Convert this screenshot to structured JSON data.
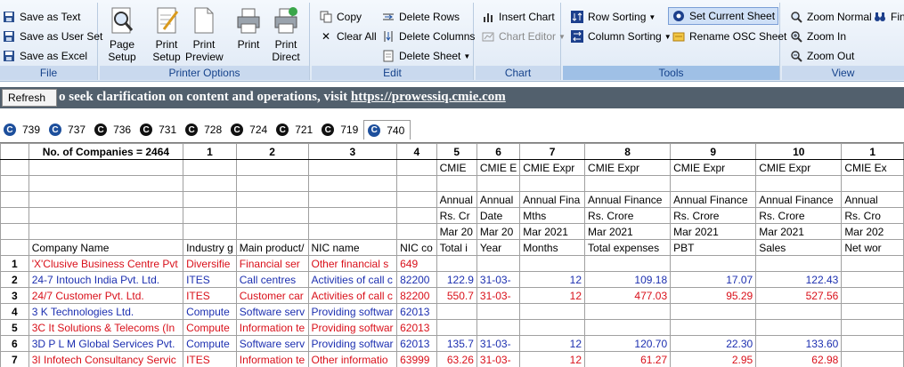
{
  "ribbon": {
    "file": {
      "label": "File",
      "items": [
        "Save as Text",
        "Save as User Set",
        "Save as Excel"
      ]
    },
    "printer": {
      "label": "Printer Options",
      "buttons": [
        {
          "line1": "Page",
          "line2": "Setup"
        },
        {
          "line1": "Print",
          "line2": "Setup"
        },
        {
          "line1": "Print",
          "line2": "Preview"
        },
        {
          "line1": "Print",
          "line2": ""
        },
        {
          "line1": "Print",
          "line2": "Direct"
        }
      ]
    },
    "edit": {
      "label": "Edit",
      "copy": "Copy",
      "clear_all": "Clear All",
      "delete_rows": "Delete Rows",
      "delete_columns": "Delete Columns",
      "delete_sheet": "Delete Sheet"
    },
    "chart": {
      "label": "Chart",
      "insert_chart": "Insert Chart",
      "chart_editor": "Chart Editor"
    },
    "tools": {
      "label": "Tools",
      "row_sorting": "Row Sorting",
      "column_sorting": "Column Sorting",
      "set_current_sheet": "Set Current Sheet",
      "rename_osc_sheet": "Rename OSC Sheet"
    },
    "view": {
      "label": "View",
      "zoom_normal": "Zoom Normal",
      "zoom_in": "Zoom In",
      "zoom_out": "Zoom Out",
      "find": "Find"
    }
  },
  "infobar": {
    "refresh": "Refresh",
    "text": "o seek clarification on content and operations, visit ",
    "link": "https://prowessiq.cmie.com"
  },
  "tabs": [
    {
      "label": "739",
      "style": "blue",
      "active": false
    },
    {
      "label": "737",
      "style": "blue",
      "active": false
    },
    {
      "label": "736",
      "style": "black",
      "active": false
    },
    {
      "label": "731",
      "style": "black",
      "active": false
    },
    {
      "label": "728",
      "style": "black",
      "active": false
    },
    {
      "label": "724",
      "style": "black",
      "active": false
    },
    {
      "label": "721",
      "style": "black",
      "active": false
    },
    {
      "label": "719",
      "style": "black",
      "active": false
    },
    {
      "label": "740",
      "style": "blue",
      "active": true
    }
  ],
  "grid": {
    "header": [
      "",
      "No. of Companies = 2464",
      "1",
      "2",
      "3",
      "4",
      "5",
      "6",
      "7",
      "8",
      "9",
      "10",
      "1"
    ],
    "meta_rows": [
      [
        "",
        "",
        "",
        "",
        "",
        "",
        "CMIE",
        "CMIE E",
        "CMIE Expr",
        "CMIE Expr",
        "CMIE Expr",
        "CMIE Expr",
        "CMIE Ex"
      ],
      [
        "",
        "",
        "",
        "",
        "",
        "",
        "",
        "",
        "",
        "",
        "",
        "",
        ""
      ],
      [
        "",
        "",
        "",
        "",
        "",
        "",
        "Annual",
        "Annual",
        "Annual Fina",
        "Annual Finance",
        "Annual Finance",
        "Annual Finance",
        "Annual"
      ],
      [
        "",
        "",
        "",
        "",
        "",
        "",
        "Rs. Cr",
        "Date",
        "Mths",
        "Rs. Crore",
        "Rs. Crore",
        "Rs. Crore",
        "Rs. Cro"
      ],
      [
        "",
        "",
        "",
        "",
        "",
        "",
        "Mar 20",
        "Mar 20",
        "Mar 2021",
        "Mar 2021",
        "Mar 2021",
        "Mar 2021",
        "Mar 202"
      ],
      [
        "",
        "Company Name",
        "Industry g",
        "Main product/",
        "NIC name",
        "NIC co",
        "Total i",
        "Year",
        "Months",
        "Total expenses",
        "PBT",
        "Sales",
        "Net wor"
      ]
    ],
    "rows": [
      {
        "n": "1",
        "color": "red",
        "cells": [
          "'X'Clusive Business Centre Pvt",
          "Diversifie",
          "Financial ser",
          "Other financial s",
          "649",
          "",
          "",
          "",
          "",
          "",
          "",
          ""
        ]
      },
      {
        "n": "2",
        "color": "blue",
        "cells": [
          "24-7 Intouch India Pvt. Ltd.",
          "ITES",
          "Call centres",
          "Activities of call c",
          "82200",
          "122.9",
          "31-03-",
          "12",
          "109.18",
          "17.07",
          "122.43",
          ""
        ]
      },
      {
        "n": "3",
        "color": "red",
        "cells": [
          "24/7 Customer Pvt. Ltd.",
          "ITES",
          "Customer car",
          "Activities of call c",
          "82200",
          "550.7",
          "31-03-",
          "12",
          "477.03",
          "95.29",
          "527.56",
          ""
        ]
      },
      {
        "n": "4",
        "color": "blue",
        "cells": [
          "3 K Technologies Ltd.",
          "Compute",
          "Software serv",
          "Providing softwar",
          "62013",
          "",
          "",
          "",
          "",
          "",
          "",
          ""
        ]
      },
      {
        "n": "5",
        "color": "red",
        "cells": [
          "3C It Solutions & Telecoms (In",
          "Compute",
          "Information te",
          "Providing softwar",
          "62013",
          "",
          "",
          "",
          "",
          "",
          "",
          ""
        ]
      },
      {
        "n": "6",
        "color": "blue",
        "cells": [
          "3D P L M Global Services Pvt.",
          "Compute",
          "Software serv",
          "Providing softwar",
          "62013",
          "135.7",
          "31-03-",
          "12",
          "120.70",
          "22.30",
          "133.60",
          ""
        ]
      },
      {
        "n": "7",
        "color": "red",
        "cells": [
          "3I Infotech Consultancy Servic",
          "ITES",
          "Information te",
          "Other informatio",
          "63999",
          "63.26",
          "31-03-",
          "12",
          "61.27",
          "2.95",
          "62.98",
          ""
        ]
      }
    ]
  }
}
